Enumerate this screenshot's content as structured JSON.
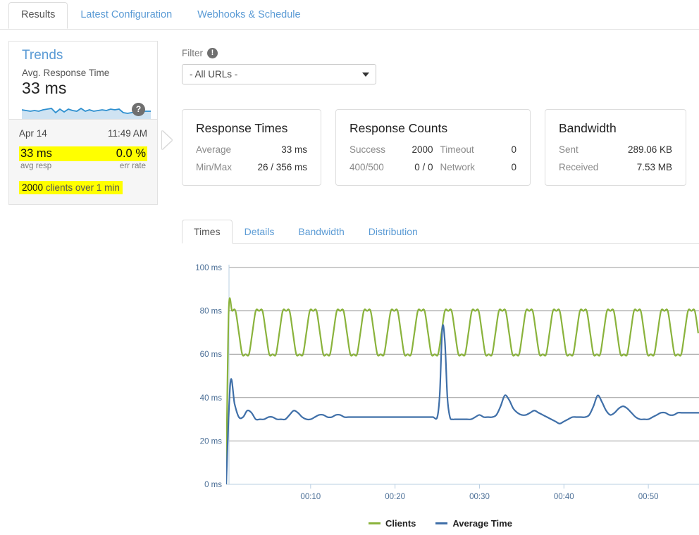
{
  "top_tabs": [
    {
      "label": "Results",
      "active": true
    },
    {
      "label": "Latest Configuration",
      "active": false
    },
    {
      "label": "Webhooks & Schedule",
      "active": false
    }
  ],
  "sidebar": {
    "title": "Trends",
    "subtitle": "Avg. Response Time",
    "value": "33 ms",
    "sparkline_badge": "?",
    "card": {
      "date": "Apr 14",
      "time": "11:49 AM",
      "avg_resp_value": "33 ms",
      "err_rate_value": "0.0 %",
      "avg_resp_label": "avg resp",
      "err_rate_label": "err rate",
      "clients_count": "2000",
      "clients_text": "clients over 1 min"
    }
  },
  "filter": {
    "label": "Filter",
    "info_icon": "!",
    "selected": "- All URLs -",
    "options": [
      "- All URLs -"
    ]
  },
  "cards": [
    {
      "title": "Response Times",
      "rows": [
        {
          "k": "Average",
          "v": "33 ms"
        },
        {
          "k": "Min/Max",
          "v": "26 / 356 ms"
        }
      ]
    },
    {
      "title": "Response Counts",
      "rows": [
        {
          "k1": "Success",
          "v1": "2000",
          "k2": "Timeout",
          "v2": "0"
        },
        {
          "k1": "400/500",
          "v1": "0 / 0",
          "k2": "Network",
          "v2": "0"
        }
      ]
    },
    {
      "title": "Bandwidth",
      "rows": [
        {
          "k": "Sent",
          "v": "289.06 KB"
        },
        {
          "k": "Received",
          "v": "7.53 MB"
        }
      ]
    }
  ],
  "inner_tabs": [
    {
      "label": "Times",
      "active": true
    },
    {
      "label": "Details",
      "active": false
    },
    {
      "label": "Bandwidth",
      "active": false
    },
    {
      "label": "Distribution",
      "active": false
    }
  ],
  "chart_data": {
    "type": "line",
    "title": "",
    "xlabel": "",
    "ylabel": "",
    "ylim": [
      0,
      100
    ],
    "yticks": [
      0,
      20,
      40,
      60,
      80,
      100
    ],
    "ytick_labels": [
      "0 ms",
      "20 ms",
      "40 ms",
      "60 ms",
      "80 ms",
      "100 ms"
    ],
    "xlim": [
      0,
      56
    ],
    "xticks": [
      10,
      20,
      30,
      40,
      50
    ],
    "xtick_labels": [
      "00:10",
      "00:20",
      "00:30",
      "00:40",
      "00:50"
    ],
    "grid": true,
    "legend_position": "bottom",
    "colors": {
      "clients": "#8ab33c",
      "average_time": "#3f6fa8"
    },
    "series": [
      {
        "name": "Clients",
        "color": "#8ab33c",
        "x": [
          0.0,
          0.3,
          0.7,
          1.1,
          1.5,
          1.9,
          2.3,
          2.7,
          3.1,
          3.5,
          3.9,
          4.3,
          4.7,
          5.1,
          5.5,
          5.9,
          6.3,
          6.7,
          7.1,
          7.5,
          7.9,
          8.3,
          8.7,
          9.1,
          9.5,
          9.9,
          10.3,
          10.7,
          11.1,
          11.5,
          11.9,
          12.3,
          12.7,
          13.1,
          13.5,
          13.9,
          14.3,
          14.7,
          15.1,
          15.5,
          15.9,
          16.3,
          16.7,
          17.1,
          17.5,
          17.9,
          18.3,
          18.7,
          19.1,
          19.5,
          19.9,
          20.3,
          20.7,
          21.1,
          21.5,
          21.9,
          22.3,
          22.7,
          23.1,
          23.5,
          23.9,
          24.3,
          24.7,
          25.1,
          25.5,
          25.9,
          26.3,
          26.7,
          27.1,
          27.5,
          27.9,
          28.3,
          28.7,
          29.1,
          29.5,
          29.9,
          30.3,
          30.7,
          31.1,
          31.5,
          31.9,
          32.3,
          32.7,
          33.1,
          33.5,
          33.9,
          34.3,
          34.7,
          35.1,
          35.5,
          35.9,
          36.3,
          36.7,
          37.1,
          37.5,
          37.9,
          38.3,
          38.7,
          39.1,
          39.5,
          39.9,
          40.3,
          40.7,
          41.1,
          41.5,
          41.9,
          42.3,
          42.7,
          43.1,
          43.5,
          43.9,
          44.3,
          44.7,
          45.1,
          45.5,
          45.9,
          46.3,
          46.7,
          47.1,
          47.5,
          47.9,
          48.3,
          48.7,
          49.1,
          49.5,
          49.9,
          50.3,
          50.7,
          51.1,
          51.5,
          51.9,
          52.3,
          52.7,
          53.1,
          53.5,
          53.9,
          54.3,
          54.7,
          55.1,
          55.5,
          55.9
        ],
        "y": [
          0,
          80,
          80,
          80,
          70,
          60,
          60,
          60,
          70,
          80,
          80,
          80,
          70,
          60,
          60,
          60,
          70,
          80,
          80,
          80,
          70,
          60,
          60,
          60,
          70,
          80,
          80,
          80,
          70,
          60,
          60,
          60,
          70,
          80,
          80,
          80,
          70,
          60,
          60,
          60,
          70,
          80,
          80,
          80,
          70,
          60,
          60,
          60,
          70,
          80,
          80,
          80,
          70,
          60,
          60,
          60,
          70,
          80,
          80,
          80,
          70,
          60,
          60,
          60,
          70,
          80,
          80,
          80,
          70,
          60,
          60,
          60,
          70,
          80,
          80,
          80,
          70,
          60,
          60,
          60,
          70,
          80,
          80,
          80,
          70,
          60,
          60,
          60,
          70,
          80,
          80,
          80,
          70,
          60,
          60,
          60,
          70,
          80,
          80,
          80,
          70,
          60,
          60,
          60,
          70,
          80,
          80,
          80,
          70,
          60,
          60,
          60,
          70,
          80,
          80,
          80,
          70,
          60,
          60,
          60,
          70,
          80,
          80,
          80,
          70,
          60,
          60,
          60,
          70,
          80,
          80,
          80,
          70,
          60,
          60,
          60,
          70,
          80,
          80,
          80,
          70
        ],
        "note": "square-wave oscillating between 60 and 80 ms, period ~2.2s, starting with a vertical rise from 0 to 80 at t=0"
      },
      {
        "name": "Average Time",
        "color": "#3f6fa8",
        "x": [
          0.0,
          0.5,
          1.0,
          1.5,
          2.0,
          2.5,
          3.0,
          3.5,
          4.0,
          4.5,
          5.0,
          5.5,
          6.0,
          6.5,
          7.0,
          7.5,
          8.0,
          8.5,
          9.0,
          9.5,
          10.0,
          10.5,
          11.0,
          11.5,
          12.0,
          12.5,
          13.0,
          13.5,
          14.0,
          14.5,
          15.0,
          15.5,
          16.0,
          16.5,
          17.0,
          17.5,
          18.0,
          18.5,
          19.0,
          19.5,
          20.0,
          20.5,
          21.0,
          21.5,
          22.0,
          22.5,
          23.0,
          23.5,
          24.0,
          24.5,
          25.0,
          25.3,
          25.6,
          25.9,
          26.2,
          26.5,
          26.8,
          27.1,
          27.5,
          28.0,
          28.5,
          29.0,
          29.5,
          30.0,
          30.5,
          31.0,
          31.5,
          32.0,
          32.5,
          33.0,
          33.5,
          34.0,
          34.5,
          35.0,
          35.5,
          36.0,
          36.5,
          37.0,
          37.5,
          38.0,
          38.5,
          39.0,
          39.5,
          40.0,
          40.5,
          41.0,
          41.5,
          42.0,
          42.5,
          43.0,
          43.5,
          44.0,
          44.5,
          45.0,
          45.5,
          46.0,
          46.5,
          47.0,
          47.5,
          48.0,
          48.5,
          49.0,
          49.5,
          50.0,
          50.5,
          51.0,
          51.5,
          52.0,
          52.5,
          53.0,
          53.5,
          54.0,
          54.5,
          55.0,
          55.5,
          56.0
        ],
        "y": [
          0,
          47,
          37,
          31,
          31,
          34,
          33,
          30,
          30,
          30,
          31,
          31,
          30,
          30,
          30,
          32,
          34,
          33,
          31,
          30,
          30,
          31,
          32,
          32,
          31,
          31,
          32,
          32,
          31,
          31,
          31,
          31,
          31,
          31,
          31,
          31,
          31,
          31,
          31,
          31,
          31,
          31,
          31,
          31,
          31,
          31,
          31,
          31,
          31,
          31,
          31,
          42,
          72,
          66,
          40,
          31,
          30,
          30,
          30,
          30,
          30,
          30,
          31,
          32,
          31,
          31,
          31,
          32,
          36,
          41,
          39,
          35,
          33,
          32,
          32,
          33,
          34,
          33,
          32,
          31,
          30,
          29,
          28,
          29,
          30,
          31,
          31,
          31,
          31,
          32,
          36,
          41,
          38,
          34,
          32,
          33,
          35,
          36,
          35,
          33,
          31,
          30,
          30,
          30,
          31,
          32,
          33,
          33,
          32,
          32,
          33,
          33,
          33,
          33,
          33,
          33
        ],
        "note": "steep rise to ~47ms peak at t=0.5, settles near 31ms, major spike to ~72ms at t≈25.6, smaller bumps ~41ms at t≈33.5 and t≈44, ~36ms at t≈47"
      }
    ],
    "legend": [
      {
        "label": "Clients",
        "color": "#8ab33c"
      },
      {
        "label": "Average Time",
        "color": "#3f6fa8"
      }
    ]
  }
}
